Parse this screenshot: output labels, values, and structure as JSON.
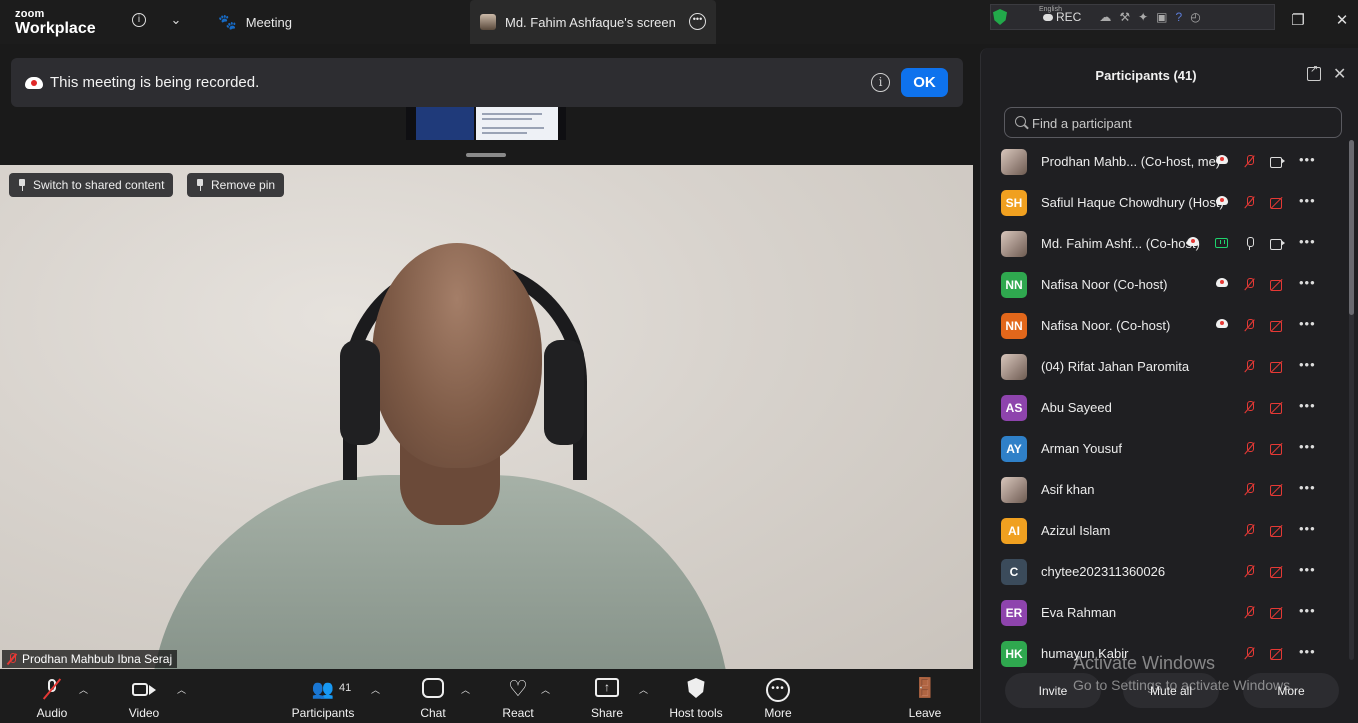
{
  "app": {
    "logo_line1": "zoom",
    "logo_line2": "Workplace"
  },
  "tabs": [
    {
      "label": "Meeting",
      "icon": "paw-icon"
    },
    {
      "label": "Md. Fahim Ashfaque's screen",
      "icon": "avatar"
    }
  ],
  "system_tray": {
    "rec_label": "REC",
    "lang_label": "English"
  },
  "banner": {
    "text": "This meeting is being recorded.",
    "ok_label": "OK"
  },
  "video": {
    "switch_label": "Switch to shared content",
    "remove_pin_label": "Remove pin",
    "speaker_name": "Prodhan Mahbub Ibna Seraj"
  },
  "toolbar": {
    "audio": "Audio",
    "video": "Video",
    "participants": "Participants",
    "participants_count": "41",
    "chat": "Chat",
    "react": "React",
    "share": "Share",
    "host_tools": "Host tools",
    "more": "More",
    "leave": "Leave"
  },
  "panel": {
    "title": "Participants (41)",
    "search_placeholder": "Find a participant",
    "invite": "Invite",
    "mute_all": "Mute all",
    "more": "More"
  },
  "participants": [
    {
      "name": "Prodhan Mahb...  (Co-host, me)",
      "avatar": "",
      "color": "",
      "rec": true,
      "share": false,
      "mic": "muted",
      "cam": "on"
    },
    {
      "name": "Safiul Haque Chowdhury (Host)",
      "avatar": "SH",
      "color": "#f0a020",
      "rec": true,
      "share": false,
      "mic": "muted",
      "cam": "off"
    },
    {
      "name": "Md. Fahim Ashf... (Co-host)",
      "avatar": "",
      "color": "",
      "rec": true,
      "share": true,
      "mic": "on",
      "cam": "on"
    },
    {
      "name": "Nafisa Noor (Co-host)",
      "avatar": "NN",
      "color": "#2fa84f",
      "rec": true,
      "share": false,
      "mic": "muted",
      "cam": "off"
    },
    {
      "name": "Nafisa Noor. (Co-host)",
      "avatar": "NN",
      "color": "#e2671b",
      "rec": true,
      "share": false,
      "mic": "muted",
      "cam": "off"
    },
    {
      "name": "(04) Rifat Jahan Paromita",
      "avatar": "",
      "color": "",
      "rec": false,
      "share": false,
      "mic": "muted",
      "cam": "off"
    },
    {
      "name": "Abu Sayeed",
      "avatar": "AS",
      "color": "#8e44ad",
      "rec": false,
      "share": false,
      "mic": "muted",
      "cam": "off"
    },
    {
      "name": "Arman Yousuf",
      "avatar": "AY",
      "color": "#2f80c8",
      "rec": false,
      "share": false,
      "mic": "muted",
      "cam": "off"
    },
    {
      "name": "Asif khan",
      "avatar": "",
      "color": "",
      "rec": false,
      "share": false,
      "mic": "muted",
      "cam": "off"
    },
    {
      "name": "Azizul Islam",
      "avatar": "AI",
      "color": "#f0a020",
      "rec": false,
      "share": false,
      "mic": "muted",
      "cam": "off"
    },
    {
      "name": "chytee202311360026",
      "avatar": "C",
      "color": "#3b4b5b",
      "rec": false,
      "share": false,
      "mic": "muted",
      "cam": "off"
    },
    {
      "name": "Eva Rahman",
      "avatar": "ER",
      "color": "#8e44ad",
      "rec": false,
      "share": false,
      "mic": "muted",
      "cam": "off"
    },
    {
      "name": "humayun Kabir",
      "avatar": "HK",
      "color": "#2fa84f",
      "rec": false,
      "share": false,
      "mic": "muted",
      "cam": "off"
    }
  ],
  "watermark": {
    "line1": "Activate Windows",
    "line2": "Go to Settings to activate Windows."
  }
}
